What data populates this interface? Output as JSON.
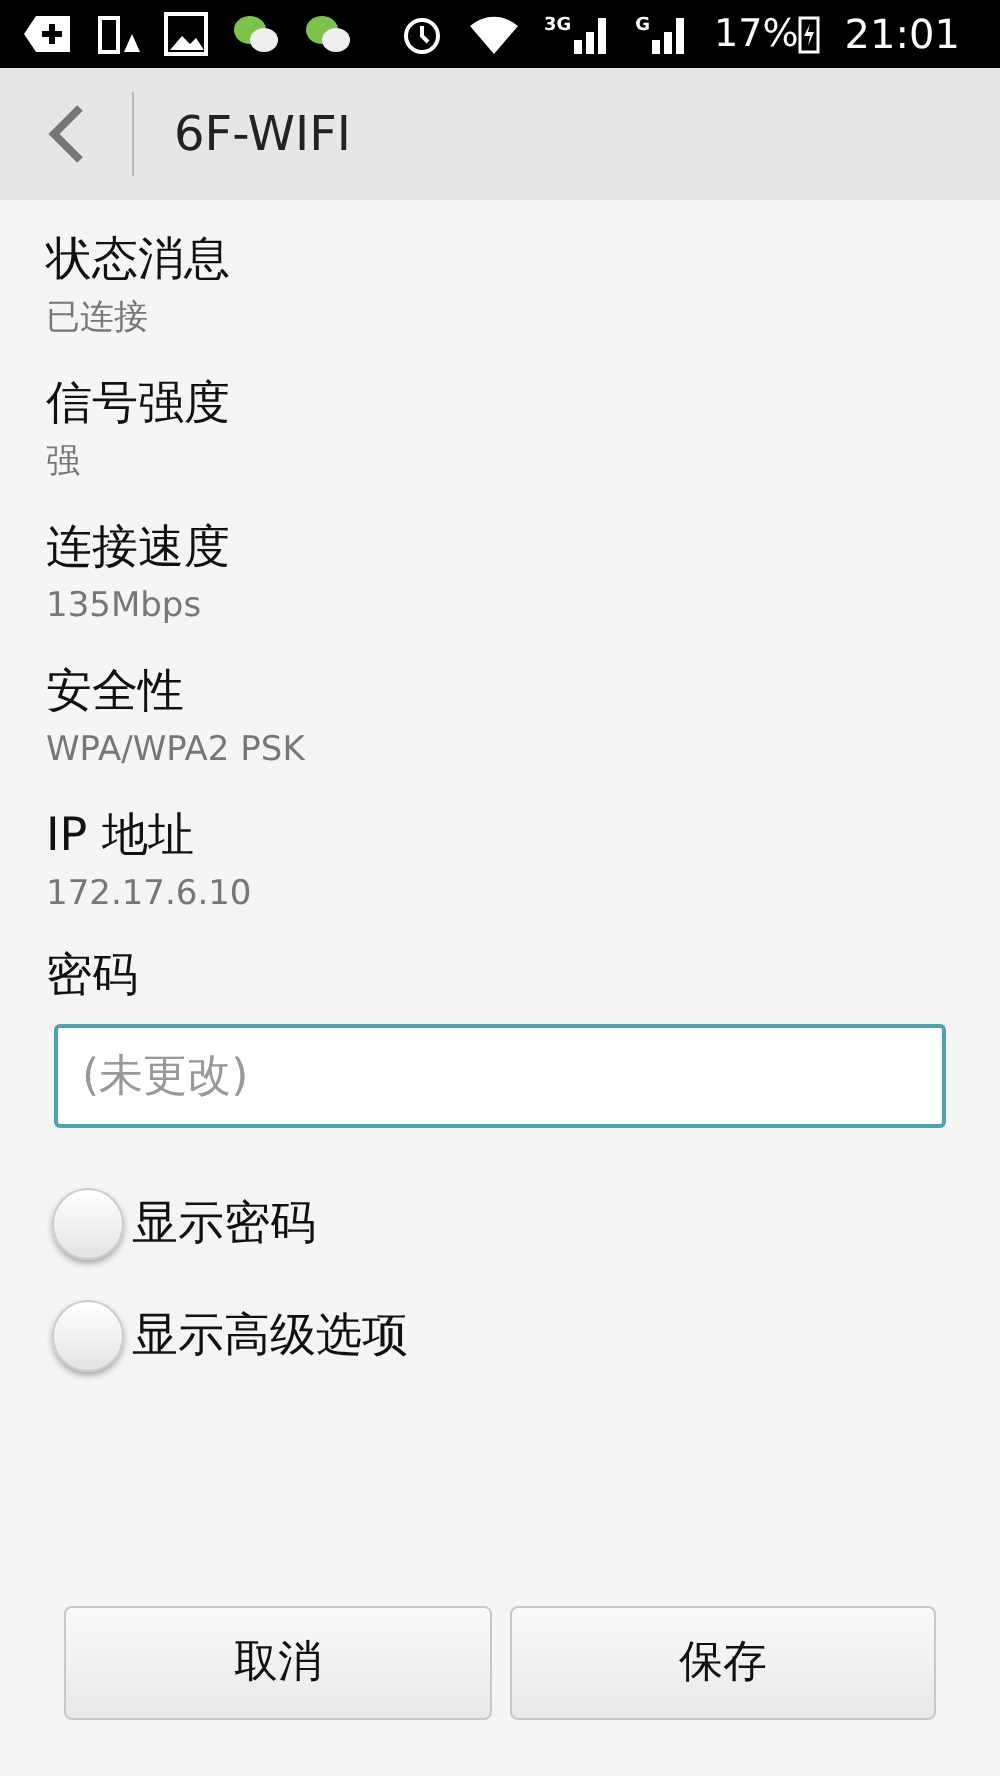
{
  "status_bar": {
    "network_3g": "3G",
    "network_g": "G",
    "battery": "17%",
    "time": "21:01"
  },
  "header": {
    "title": "6F-WIFI"
  },
  "details": [
    {
      "label": "状态消息",
      "value": "已连接"
    },
    {
      "label": "信号强度",
      "value": "强"
    },
    {
      "label": "连接速度",
      "value": "135Mbps"
    },
    {
      "label": "安全性",
      "value": "WPA/WPA2 PSK"
    },
    {
      "label": "IP 地址",
      "value": "172.17.6.10"
    }
  ],
  "password": {
    "label": "密码",
    "placeholder": "(未更改)"
  },
  "options": [
    {
      "label": "显示密码",
      "checked": false
    },
    {
      "label": "显示高级选项",
      "checked": false
    }
  ],
  "buttons": [
    "取消",
    "保存"
  ]
}
